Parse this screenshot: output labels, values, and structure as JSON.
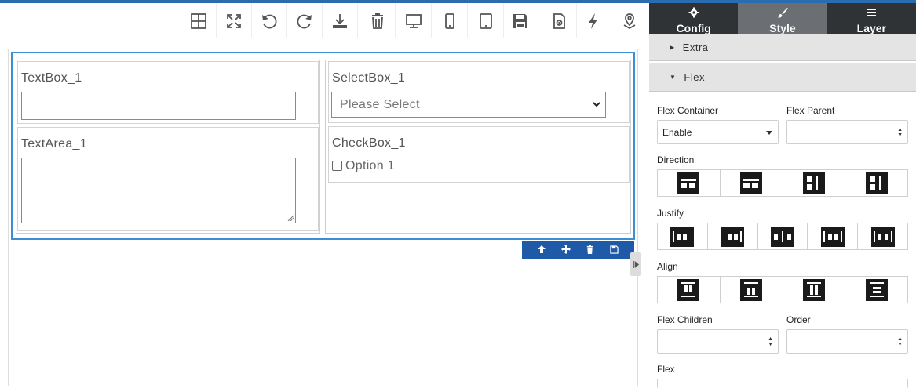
{
  "canvas": {
    "form": {
      "textbox_label": "TextBox_1",
      "textarea_label": "TextArea_1",
      "selectbox_label": "SelectBox_1",
      "select_placeholder": "Please Select",
      "checkbox_label": "CheckBox_1",
      "checkbox_option": "Option 1"
    },
    "row_actions": [
      "arrow-up-icon",
      "move-icon",
      "trash-icon",
      "save-icon"
    ]
  },
  "toolbar": {
    "icons": [
      "grid-icon",
      "fullscreen-icon",
      "undo-icon",
      "redo-icon",
      "download-icon",
      "trash-icon",
      "desktop-icon",
      "mobile-icon",
      "tablet-icon",
      "save-icon",
      "settings-file-icon",
      "lightning-icon",
      "location-pin-icon"
    ]
  },
  "panel": {
    "tabs": [
      {
        "label": "Config",
        "icon": "gear-icon",
        "active": false
      },
      {
        "label": "Style",
        "icon": "brush-icon",
        "active": true
      },
      {
        "label": "Layer",
        "icon": "bars-icon",
        "active": false
      }
    ],
    "sections": {
      "extra": "Extra",
      "flex": "Flex"
    },
    "flex_container_label": "Flex Container",
    "flex_container_value": "Enable",
    "flex_parent_label": "Flex Parent",
    "direction_label": "Direction",
    "justify_label": "Justify",
    "align_label": "Align",
    "flex_children_label": "Flex Children",
    "order_label": "Order",
    "flex_label": "Flex"
  },
  "colors": {
    "accent": "#2b6cb0",
    "row_selected_border": "#3b8fd4",
    "row_actions_bg": "#1f5aa8",
    "panel_tabs_bg": "#2f3336",
    "panel_tab_active": "#6b6f73"
  }
}
